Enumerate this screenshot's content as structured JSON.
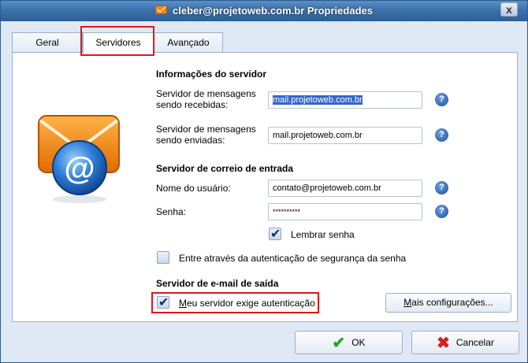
{
  "window": {
    "title": "cleber@projetoweb.com.br Propriedades",
    "close_glyph": "x"
  },
  "tabs": [
    {
      "label": "Geral"
    },
    {
      "label": "Servidores"
    },
    {
      "label": "Avançado"
    }
  ],
  "server_info": {
    "heading": "Informações do servidor",
    "incoming_label": "Servidor de mensagens sendo recebidas:",
    "incoming_value": "mail.projetoweb.com.br",
    "outgoing_label": "Servidor de mensagens sendo enviadas:",
    "outgoing_value": "mail.projetoweb.com.br"
  },
  "incoming_mail": {
    "heading": "Servidor de correio de entrada",
    "username_label": "Nome do usuário:",
    "username_value": "contato@projetoweb.com.br",
    "password_label": "Senha:",
    "password_value": "**********",
    "remember_label": "Lembrar senha",
    "remember_checked": true,
    "secure_auth_label": "Entre através da autenticação de segurança da senha",
    "secure_auth_checked": false
  },
  "outgoing_mail": {
    "heading": "Servidor de e-mail de saída",
    "auth_label": "Meu servidor exige autenticação",
    "auth_checked": true,
    "more_settings_label": "Mais configurações..."
  },
  "buttons": {
    "ok_label": "OK",
    "cancel_label": "Cancelar"
  },
  "help_glyph": "?",
  "icons": {
    "title": "envelope-icon",
    "illustration": "mail-at-icon",
    "help": "help-icon",
    "ok": "checkmark-icon",
    "cancel": "cross-icon"
  },
  "colors": {
    "accent": "#3366cc",
    "highlight": "#e0161a",
    "envelope": "#f08a1a"
  }
}
